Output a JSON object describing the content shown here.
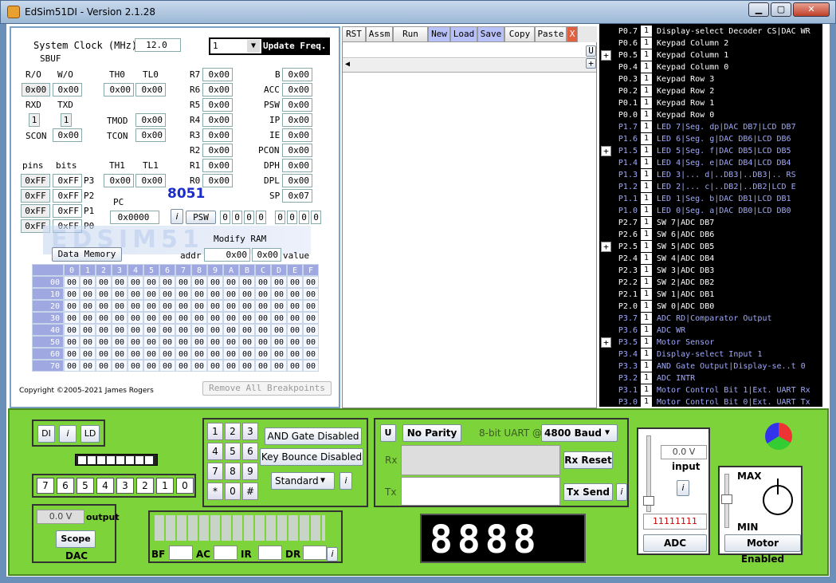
{
  "window": {
    "title": "EdSim51DI - Version 2.1.28"
  },
  "cpu": {
    "system_clock_label": "System Clock (MHz)",
    "system_clock_value": "12.0",
    "update_freq_value": "1",
    "update_freq_label": "Update Freq.",
    "sbuf_label": "SBUF",
    "ro_label": "R/O",
    "wo_label": "W/O",
    "sbuf_ro": "0x00",
    "sbuf_wo": "0x00",
    "th0_label": "TH0",
    "tl0_label": "TL0",
    "th0": "0x00",
    "tl0": "0x00",
    "rxd_label": "RXD",
    "txd_label": "TXD",
    "rxd": "1",
    "txd": "1",
    "tmod_label": "TMOD",
    "tmod": "0x00",
    "scon_label": "SCON",
    "scon": "0x00",
    "tcon_label": "TCON",
    "tcon": "0x00",
    "pins_label": "pins",
    "bits_label": "bits",
    "th1_label": "TH1",
    "tl1_label": "TL1",
    "th1": "0x00",
    "tl1": "0x00",
    "ports": [
      {
        "pins": "0xFF",
        "bits": "0xFF",
        "name": "P3"
      },
      {
        "pins": "0xFF",
        "bits": "0xFF",
        "name": "P2"
      },
      {
        "pins": "0xFF",
        "bits": "0xFF",
        "name": "P1"
      },
      {
        "pins": "0xFF",
        "bits": "0xFF",
        "name": "P0"
      }
    ],
    "regs_left": [
      {
        "name": "R7",
        "value": "0x00"
      },
      {
        "name": "R6",
        "value": "0x00"
      },
      {
        "name": "R5",
        "value": "0x00"
      },
      {
        "name": "R4",
        "value": "0x00"
      },
      {
        "name": "R3",
        "value": "0x00"
      },
      {
        "name": "R2",
        "value": "0x00"
      },
      {
        "name": "R1",
        "value": "0x00"
      },
      {
        "name": "R0",
        "value": "0x00"
      }
    ],
    "regs_right": [
      {
        "name": "B",
        "value": "0x00"
      },
      {
        "name": "ACC",
        "value": "0x00"
      },
      {
        "name": "PSW",
        "value": "0x00"
      },
      {
        "name": "IP",
        "value": "0x00"
      },
      {
        "name": "IE",
        "value": "0x00"
      },
      {
        "name": "PCON",
        "value": "0x00"
      },
      {
        "name": "DPH",
        "value": "0x00"
      },
      {
        "name": "DPL",
        "value": "0x00"
      },
      {
        "name": "SP",
        "value": "0x07"
      }
    ],
    "chip_label": "8051",
    "pc_label": "PC",
    "pc_value": "0x0000",
    "info_label": "i",
    "psw_button": "PSW",
    "psw_bits": [
      "0",
      "0",
      "0",
      "0",
      "0",
      "0",
      "0",
      "0"
    ],
    "modify_ram_label": "Modify RAM",
    "data_memory_button": "Data Memory",
    "addr_label": "addr",
    "addr_value": "0x00",
    "value_value": "0x00",
    "value_label": "value",
    "ram_cols": [
      "0",
      "1",
      "2",
      "3",
      "4",
      "5",
      "6",
      "7",
      "8",
      "9",
      "A",
      "B",
      "C",
      "D",
      "E",
      "F"
    ],
    "ram_rows": [
      "00",
      "10",
      "20",
      "30",
      "40",
      "50",
      "60",
      "70"
    ],
    "ram_cell": "00",
    "copyright": "Copyright ©2005-2021 James Rogers",
    "remove_breakpoints": "Remove All Breakpoints"
  },
  "toolbar": {
    "buttons": [
      "RST",
      "Assm",
      "Run",
      "New",
      "Load",
      "Save",
      "Copy",
      "Paste"
    ],
    "close": "X",
    "u_label": "U",
    "plus": "+"
  },
  "pins": [
    {
      "name": "P0.7",
      "val": "1",
      "desc": "Display-select Decoder CS|DAC WR",
      "color": "#ffffff"
    },
    {
      "name": "P0.6",
      "val": "1",
      "desc": "Keypad Column 2",
      "color": "#ffffff"
    },
    {
      "name": "P0.5",
      "val": "1",
      "desc": "Keypad Column 1",
      "color": "#ffffff"
    },
    {
      "name": "P0.4",
      "val": "1",
      "desc": "Keypad Column 0",
      "color": "#ffffff"
    },
    {
      "name": "P0.3",
      "val": "1",
      "desc": "Keypad Row 3",
      "color": "#ffffff"
    },
    {
      "name": "P0.2",
      "val": "1",
      "desc": "Keypad Row 2",
      "color": "#ffffff"
    },
    {
      "name": "P0.1",
      "val": "1",
      "desc": "Keypad Row 1",
      "color": "#ffffff"
    },
    {
      "name": "P0.0",
      "val": "1",
      "desc": "Keypad Row 0",
      "color": "#ffffff"
    },
    {
      "name": "P1.7",
      "val": "1",
      "desc": "LED 7|Seg. dp|DAC DB7|LCD DB7",
      "color": "#9fa8ff"
    },
    {
      "name": "P1.6",
      "val": "1",
      "desc": "LED 6|Seg. g|DAC DB6|LCD DB6",
      "color": "#9fa8ff"
    },
    {
      "name": "P1.5",
      "val": "1",
      "desc": "LED 5|Seg. f|DAC DB5|LCD DB5",
      "color": "#9fa8ff"
    },
    {
      "name": "P1.4",
      "val": "1",
      "desc": "LED 4|Seg. e|DAC DB4|LCD DB4",
      "color": "#9fa8ff"
    },
    {
      "name": "P1.3",
      "val": "1",
      "desc": "LED 3|... d|..DB3|..DB3|.. RS",
      "color": "#9fa8ff"
    },
    {
      "name": "P1.2",
      "val": "1",
      "desc": "LED 2|... c|..DB2|..DB2|LCD E",
      "color": "#9fa8ff"
    },
    {
      "name": "P1.1",
      "val": "1",
      "desc": "LED 1|Seg. b|DAC DB1|LCD DB1",
      "color": "#9fa8ff"
    },
    {
      "name": "P1.0",
      "val": "1",
      "desc": "LED 0|Seg. a|DAC DB0|LCD DB0",
      "color": "#9fa8ff"
    },
    {
      "name": "P2.7",
      "val": "1",
      "desc": "SW 7|ADC DB7",
      "color": "#ffffff"
    },
    {
      "name": "P2.6",
      "val": "1",
      "desc": "SW 6|ADC DB6",
      "color": "#ffffff"
    },
    {
      "name": "P2.5",
      "val": "1",
      "desc": "SW 5|ADC DB5",
      "color": "#ffffff"
    },
    {
      "name": "P2.4",
      "val": "1",
      "desc": "SW 4|ADC DB4",
      "color": "#ffffff"
    },
    {
      "name": "P2.3",
      "val": "1",
      "desc": "SW 3|ADC DB3",
      "color": "#ffffff"
    },
    {
      "name": "P2.2",
      "val": "1",
      "desc": "SW 2|ADC DB2",
      "color": "#ffffff"
    },
    {
      "name": "P2.1",
      "val": "1",
      "desc": "SW 1|ADC DB1",
      "color": "#ffffff"
    },
    {
      "name": "P2.0",
      "val": "1",
      "desc": "SW 0|ADC DB0",
      "color": "#ffffff"
    },
    {
      "name": "P3.7",
      "val": "1",
      "desc": "ADC RD|Comparator Output",
      "color": "#9fa8ff"
    },
    {
      "name": "P3.6",
      "val": "1",
      "desc": "ADC WR",
      "color": "#9fa8ff"
    },
    {
      "name": "P3.5",
      "val": "1",
      "desc": "Motor Sensor",
      "color": "#9fa8ff"
    },
    {
      "name": "P3.4",
      "val": "1",
      "desc": "Display-select Input 1",
      "color": "#9fa8ff"
    },
    {
      "name": "P3.3",
      "val": "1",
      "desc": "AND Gate Output|Display-se..t 0",
      "color": "#9fa8ff"
    },
    {
      "name": "P3.2",
      "val": "1",
      "desc": "ADC INTR",
      "color": "#9fa8ff"
    },
    {
      "name": "P3.1",
      "val": "1",
      "desc": "Motor Control Bit 1|Ext. UART Rx",
      "color": "#9fa8ff"
    },
    {
      "name": "P3.0",
      "val": "1",
      "desc": "Motor Control Bit 0|Ext. UART Tx",
      "color": "#9fa8ff"
    }
  ],
  "periph": {
    "di": "DI",
    "i": "i",
    "ld": "LD",
    "switches": [
      "7",
      "6",
      "5",
      "4",
      "3",
      "2",
      "1",
      "0"
    ],
    "dac_value": "0.0 V",
    "dac_output": "output",
    "scope": "Scope",
    "dac": "DAC",
    "keys": [
      "1",
      "2",
      "3",
      "4",
      "5",
      "6",
      "7",
      "8",
      "9",
      "*",
      "0",
      "#"
    ],
    "and_gate": "AND Gate Disabled",
    "key_bounce": "Key Bounce Disabled",
    "keypad_mode": "Standard",
    "lcd_labels": [
      "BF",
      "AC",
      "IR",
      "DR"
    ],
    "uart_u": "U",
    "parity": "No Parity",
    "uart_label": "8-bit UART @",
    "baud": "4800 Baud",
    "rx": "Rx",
    "tx": "Tx",
    "rx_reset": "Rx Reset",
    "tx_send": "Tx Send",
    "adc_voltage": "0.0 V",
    "adc_input": "input",
    "adc_bits": "11111111",
    "adc": "ADC",
    "max": "MAX",
    "min": "MIN",
    "motor": "Motor Enabled"
  }
}
